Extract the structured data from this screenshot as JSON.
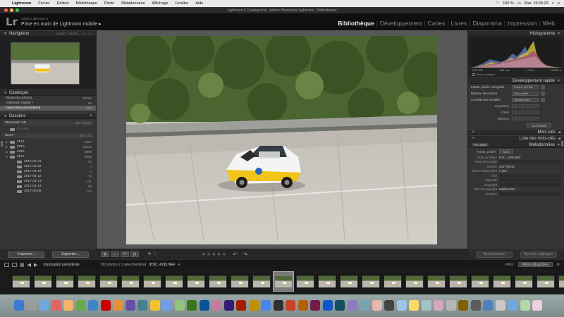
{
  "menubar": {
    "app": "Lightroom",
    "items": [
      "Fichier",
      "Edition",
      "Bibliothèque",
      "Photo",
      "Métadonnées",
      "Affichage",
      "Fenêtre",
      "Aide"
    ],
    "battery": "100 %",
    "clock": "Mar. 19:06:23"
  },
  "window": {
    "title": "Lightroom 5 Catalog.lrcat - Adobe Photoshop Lightroom - Bibliothèque"
  },
  "identity": {
    "logo": "Lr",
    "subtitle": "Adobe Lightroom 5",
    "title": "Prise en main de Lightroom mobile"
  },
  "modules": [
    "Bibliothèque",
    "Développement",
    "Cartes",
    "Livres",
    "Diaporama",
    "Impression",
    "Web"
  ],
  "left_panel": {
    "navigator": {
      "title": "Navigation",
      "zoom_options": "ADAPT. · REMPL. · 1:1 · 3:1"
    },
    "catalog": {
      "title": "Catalogue",
      "items": [
        {
          "label": "Toutes les photos",
          "count": "25765"
        },
        {
          "label": "Collection rapide +",
          "count": "96"
        },
        {
          "label": "Importation précédente",
          "count": "303"
        }
      ]
    },
    "folders": {
      "title": "Dossiers",
      "volumes": [
        {
          "name": "Macintosh HD",
          "info": "18/1 / 99 Go"
        },
        {
          "name": "home",
          "info": "9/4 / 2 To"
        }
      ],
      "volume_placeholder": "Pictures",
      "items": [
        {
          "name": "2014",
          "count": "2857",
          "level": 1
        },
        {
          "name": "2015",
          "count": "10622",
          "level": 1
        },
        {
          "name": "2016",
          "count": "8695",
          "level": 1
        },
        {
          "name": "2017",
          "count": "3029",
          "level": 1
        },
        {
          "name": "2017-01-21",
          "count": "65",
          "level": 2
        },
        {
          "name": "2017-01-22",
          "count": "4",
          "level": 2
        },
        {
          "name": "2017-03-19",
          "count": "3",
          "level": 2
        },
        {
          "name": "2017-04-12",
          "count": "73",
          "level": 2
        },
        {
          "name": "2017-04-13",
          "count": "131",
          "level": 2
        },
        {
          "name": "2017-04-14",
          "count": "98",
          "level": 2
        },
        {
          "name": "2017-05-06",
          "count": "143",
          "level": 2
        }
      ]
    },
    "buttons": {
      "import": "Importer...",
      "export": "Exporter..."
    }
  },
  "right_panel": {
    "histogram": {
      "title": "Histogramme",
      "iso": "ISO 100",
      "focal": "183 mm",
      "aperture": "f / 8,0",
      "shutter": "1/1600 s",
      "original_photo": "Photo d'origine"
    },
    "quick_develop": {
      "title": "Développement rapide",
      "preset_label": "Param. prédé. enregistré",
      "preset_value": "Param. par déf.",
      "wb_label": "Balance des blancs",
      "wb_value": "Telle quelle",
      "tone_label": "Contrôle des tonalités",
      "tone_value": "Tonalité auto",
      "adjustments": [
        "Exposition",
        "Clarté",
        "Vibrance"
      ],
      "reset": "Tout rétablir"
    },
    "keywords": "Mots-clés",
    "keyword_list": "Liste des mots-clés",
    "metadata": {
      "title": "Métadonnées",
      "view": "Par défaut",
      "preset_label": "Param. prédéf.",
      "preset_value": "Sans",
      "fields": [
        {
          "key": "Nom du fichier",
          "value": "DSC_4165.NEF"
        },
        {
          "key": "Nom de la copie",
          "value": ""
        },
        {
          "key": "Dossier",
          "value": "2017-09-21"
        },
        {
          "key": "État métadonnées",
          "value": "À jour"
        },
        {
          "key": "Titre",
          "value": ""
        },
        {
          "key": "Légende",
          "value": ""
        },
        {
          "key": "Copyright",
          "value": ""
        },
        {
          "key": "État du copyright",
          "value": "Indéterminé"
        },
        {
          "key": "Créateur",
          "value": ""
        }
      ]
    },
    "buttons": {
      "sync": "Synchroniser",
      "sync_settings": "Synchr. réglages"
    }
  },
  "filmstrip": {
    "source": "Importation précédente",
    "count": "303 photos / 1 sélectionné(e)",
    "filename": "/DSC_4165.NEF",
    "filter_label": "Filtre :",
    "filter_value": "Filtres désactivés"
  }
}
